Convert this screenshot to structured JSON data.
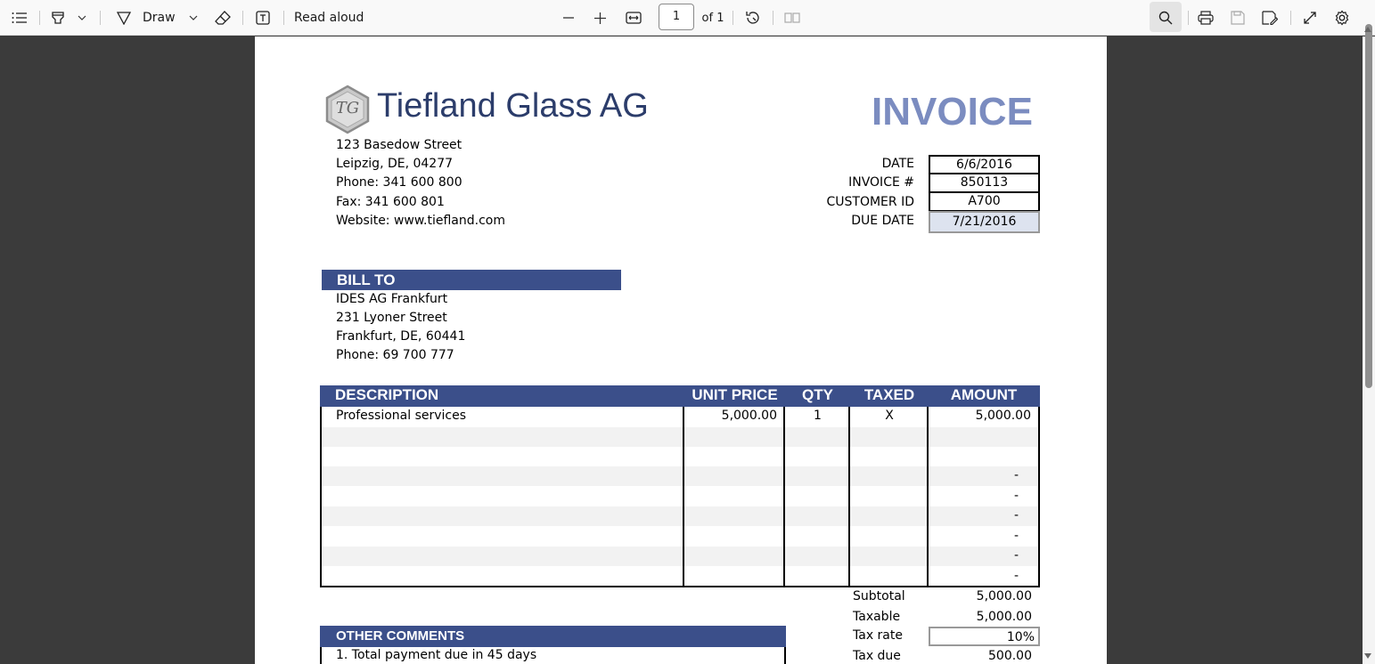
{
  "toolbar": {
    "draw_label": "Draw",
    "read_aloud_label": "Read aloud",
    "page_current": "1",
    "page_total": "of 1",
    "icons": [
      "contents-icon",
      "highlight-icon",
      "chevron-down-icon",
      "draw-icon",
      "chevron-down-icon",
      "eraser-icon",
      "text-box-icon",
      "zoom-out-icon",
      "zoom-in-icon",
      "fit-width-icon",
      "rotate-icon",
      "two-page-icon",
      "search-icon",
      "print-icon",
      "save-icon",
      "save-as-icon",
      "fullscreen-icon",
      "settings-icon"
    ]
  },
  "document": {
    "company": {
      "logo_monogram": "TG",
      "name": "Tiefland Glass AG",
      "address_lines": [
        "123 Basedow Street",
        "Leipzig, DE, 04277",
        "Phone: 341 600 800",
        "Fax: 341 600 801",
        "Website: www.tiefland.com"
      ]
    },
    "title": "INVOICE",
    "meta": [
      {
        "label": "DATE",
        "value": "6/6/2016"
      },
      {
        "label": "INVOICE #",
        "value": "850113"
      },
      {
        "label": "CUSTOMER ID",
        "value": "A700"
      },
      {
        "label": "DUE DATE",
        "value": "7/21/2016"
      }
    ],
    "bill_to": {
      "header": "BILL TO",
      "lines": [
        "IDES AG Frankfurt",
        "231 Lyoner Street",
        "Frankfurt, DE, 60441",
        "Phone: 69 700 777"
      ]
    },
    "table": {
      "headers": [
        "DESCRIPTION",
        "UNIT PRICE",
        "QTY",
        "TAXED",
        "AMOUNT"
      ],
      "rows": [
        {
          "description": "Professional services",
          "unit_price": "5,000.00",
          "qty": "1",
          "taxed": "X",
          "amount": "5,000.00"
        },
        {
          "description": "",
          "unit_price": "",
          "qty": "",
          "taxed": "",
          "amount": ""
        },
        {
          "description": "",
          "unit_price": "",
          "qty": "",
          "taxed": "",
          "amount": ""
        },
        {
          "description": "",
          "unit_price": "",
          "qty": "",
          "taxed": "",
          "amount": "-"
        },
        {
          "description": "",
          "unit_price": "",
          "qty": "",
          "taxed": "",
          "amount": "-"
        },
        {
          "description": "",
          "unit_price": "",
          "qty": "",
          "taxed": "",
          "amount": "-"
        },
        {
          "description": "",
          "unit_price": "",
          "qty": "",
          "taxed": "",
          "amount": "-"
        },
        {
          "description": "",
          "unit_price": "",
          "qty": "",
          "taxed": "",
          "amount": "-"
        },
        {
          "description": "",
          "unit_price": "",
          "qty": "",
          "taxed": "",
          "amount": "-"
        }
      ]
    },
    "totals": [
      {
        "label": "Subtotal",
        "value": "5,000.00"
      },
      {
        "label": "Taxable",
        "value": "5,000.00"
      },
      {
        "label": "Tax rate",
        "value": "10%"
      },
      {
        "label": "Tax due",
        "value": "500.00"
      }
    ],
    "comments": {
      "header": "OTHER COMMENTS",
      "lines": [
        "1. Total payment due in 45 days"
      ]
    }
  },
  "colors": {
    "band": "#3b4f8a",
    "invoice_title": "#7b8cc0",
    "company_name": "#2c3d6b",
    "row_alt": "#f2f2f2",
    "due_date_fill": "#dde3ef"
  }
}
